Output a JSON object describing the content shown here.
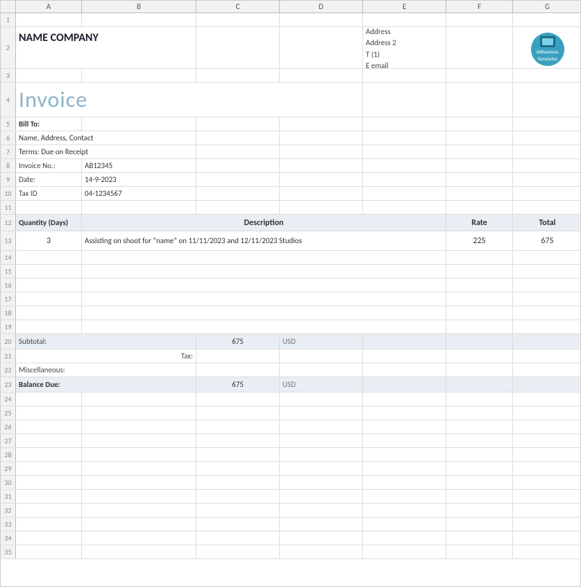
{
  "columns": [
    "A",
    "B",
    "C",
    "D",
    "E",
    "F",
    "G"
  ],
  "company": {
    "name": "NAME COMPANY",
    "address1": "Address",
    "address2": "Address 2",
    "phone": "T (1)",
    "email": "E email"
  },
  "invoice": {
    "title": "Invoice",
    "bill_to_label": "Bill To:",
    "bill_to_value": "Name, Address, Contact",
    "terms_label": "Terms: Due on Receipt",
    "invoice_no_label": "Invoice No.:",
    "invoice_no_value": "AB12345",
    "date_label": "Date:",
    "date_value": "14-9-2023",
    "tax_id_label": "Tax ID",
    "tax_id_value": "04-1234567"
  },
  "table": {
    "headers": {
      "quantity": "Quantity (Days)",
      "description": "Description",
      "rate": "Rate",
      "total": "Total"
    },
    "rows": [
      {
        "quantity": "3",
        "description": "Assisting on shoot for “name” on 11/11/2023 and 12/11/2023 Studios",
        "rate": "225",
        "total": "675"
      }
    ]
  },
  "summary": {
    "subtotal_label": "Subtotal:",
    "subtotal_value": "675",
    "subtotal_currency": "USD",
    "tax_label": "Tax:",
    "misc_label": "Miscellaneous:",
    "balance_due_label": "Balance Due:",
    "balance_due_value": "675",
    "balance_due_currency": "USD"
  },
  "logo": {
    "text_line1": "AllBusiness",
    "text_line2": "Templates"
  },
  "row_numbers": [
    1,
    2,
    3,
    4,
    5,
    6,
    7,
    8,
    9,
    10,
    11,
    12,
    13,
    14,
    15,
    16,
    17,
    18,
    19,
    20,
    21,
    22,
    23,
    24,
    25,
    26,
    27,
    28,
    29,
    30,
    31,
    32,
    33,
    34,
    35
  ]
}
